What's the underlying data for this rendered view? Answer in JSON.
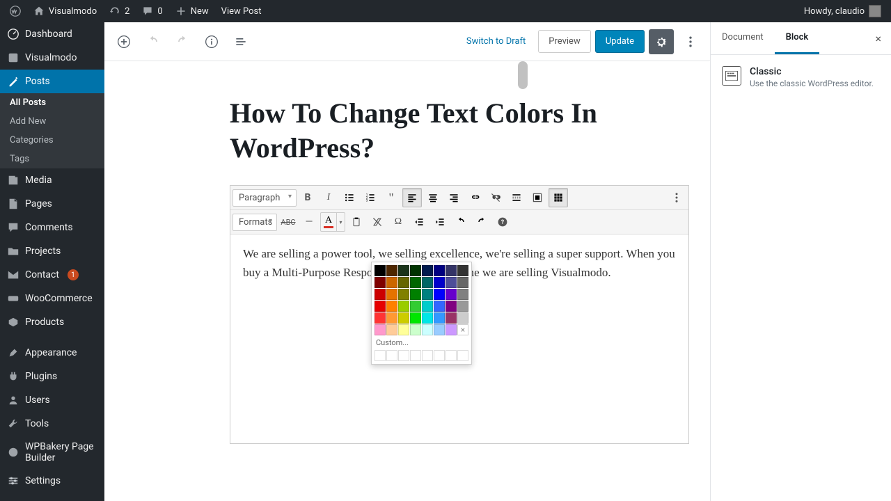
{
  "adminbar": {
    "site": "Visualmodo",
    "updates": "2",
    "comments": "0",
    "new": "New",
    "viewpost": "View Post",
    "howdy": "Howdy, claudio"
  },
  "menu": {
    "dashboard": "Dashboard",
    "visualmodo": "Visualmodo",
    "posts": "Posts",
    "submenu": {
      "all": "All Posts",
      "addnew": "Add New",
      "categories": "Categories",
      "tags": "Tags"
    },
    "media": "Media",
    "pages": "Pages",
    "comments": "Comments",
    "projects": "Projects",
    "contact": "Contact",
    "contact_badge": "1",
    "woo": "WooCommerce",
    "products": "Products",
    "appearance": "Appearance",
    "plugins": "Plugins",
    "users": "Users",
    "tools": "Tools",
    "wpbakery": "WPBakery Page Builder",
    "settings": "Settings"
  },
  "editor": {
    "switch_draft": "Switch to Draft",
    "preview": "Preview",
    "update": "Update",
    "title": "How To Change Text Colors In WordPress?",
    "paragraph_select": "Paragraph",
    "formats_select": "Formats",
    "content": "We are selling a power tool, we selling excellence, we're selling a super support. When you buy a Multi-Purpose Responsive & Retina Theme we are selling Visualmodo."
  },
  "colorpicker": {
    "custom": "Custom...",
    "rows": [
      [
        "#000000",
        "#4d2600",
        "#1a331a",
        "#003300",
        "#001a4d",
        "#000080",
        "#333366",
        "#333333"
      ],
      [
        "#800000",
        "#cc6600",
        "#666600",
        "#006600",
        "#006666",
        "#0000cc",
        "#4d4d99",
        "#666666"
      ],
      [
        "#cc0000",
        "#e67300",
        "#808000",
        "#008000",
        "#008080",
        "#0000ff",
        "#6600cc",
        "#808080"
      ],
      [
        "#e60000",
        "#ff8000",
        "#99cc00",
        "#33cc33",
        "#00cccc",
        "#3366ff",
        "#800080",
        "#999999"
      ],
      [
        "#ff3333",
        "#ff9933",
        "#cccc00",
        "#00e600",
        "#00e6e6",
        "#3399ff",
        "#993366",
        "#cccccc"
      ],
      [
        "#ff99cc",
        "#ffcc99",
        "#ffff99",
        "#ccffcc",
        "#ccffff",
        "#99ccff",
        "#cc99ff",
        "#ffffff"
      ]
    ]
  },
  "panel": {
    "tab_document": "Document",
    "tab_block": "Block",
    "block_title": "Classic",
    "block_desc": "Use the classic WordPress editor."
  }
}
